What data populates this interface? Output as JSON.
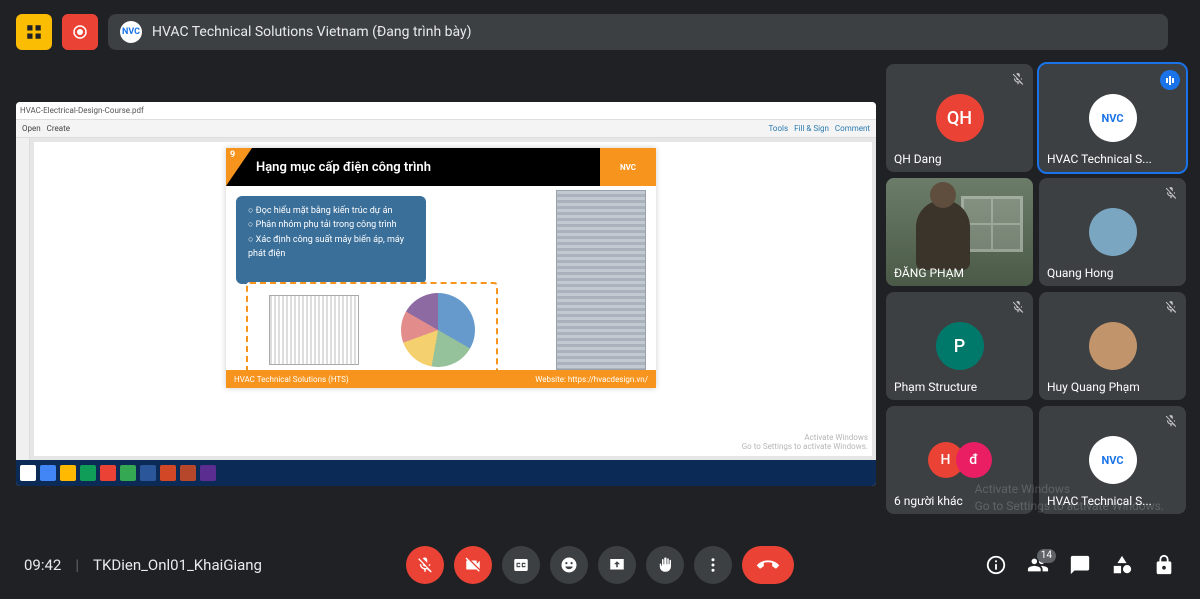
{
  "header": {
    "presenter_logo_text": "NVC",
    "presenter_label": "HVAC Technical Solutions Vietnam (Đang trình bày)"
  },
  "shared": {
    "win_title": "HVAC-Electrical-Design-Course.pdf",
    "toolbar_open": "Open",
    "toolbar_create": "Create",
    "toolbar_tools": "Tools",
    "toolbar_sign": "Fill & Sign",
    "toolbar_comment": "Comment",
    "slide_number": "9",
    "slide_title": "Hạng mục cấp điện công trình",
    "slide_logo": "NVC",
    "bullet1": "Đọc hiểu mặt bằng kiến trúc dự án",
    "bullet2": "Phân nhóm phụ tải trong công trình",
    "bullet3": "Xác định công suất máy biến áp, máy phát điện",
    "footer_left": "HVAC Technical Solutions (HTS)",
    "footer_right": "Website: https://hvacdesign.vn/",
    "watermark_title": "Activate Windows",
    "watermark_sub": "Go to Settings to activate Windows."
  },
  "participants": [
    {
      "name": "QH Dang",
      "initials": "QH",
      "color": "#ea4335",
      "muted": true,
      "speaking": false,
      "active": false,
      "type": "initials"
    },
    {
      "name": "HVAC Technical S...",
      "initials": "",
      "color": "#ffffff",
      "muted": false,
      "speaking": true,
      "active": true,
      "type": "logo"
    },
    {
      "name": "ĐĂNG PHẠM",
      "initials": "",
      "color": "",
      "muted": true,
      "speaking": false,
      "active": false,
      "type": "camera"
    },
    {
      "name": "Quang Hong",
      "initials": "",
      "color": "#7aa6c2",
      "muted": true,
      "speaking": false,
      "active": false,
      "type": "photo"
    },
    {
      "name": "Phạm Structure",
      "initials": "P",
      "color": "#00796b",
      "muted": true,
      "speaking": false,
      "active": false,
      "type": "initials"
    },
    {
      "name": "Huy Quang Phạm",
      "initials": "",
      "color": "#c2946b",
      "muted": true,
      "speaking": false,
      "active": false,
      "type": "photo"
    },
    {
      "name": "6 người khác",
      "initials": "H đ",
      "color": "",
      "muted": false,
      "speaking": false,
      "active": false,
      "type": "overflow"
    },
    {
      "name": "HVAC Technical S...",
      "initials": "",
      "color": "#ffffff",
      "muted": true,
      "speaking": false,
      "active": false,
      "type": "logo"
    }
  ],
  "bottom": {
    "time": "09:42",
    "meeting_name": "TKDien_Onl01_KhaiGiang",
    "people_count": "14"
  },
  "watermark": {
    "title": "Activate Windows",
    "sub": "Go to Settings to activate Windows."
  }
}
